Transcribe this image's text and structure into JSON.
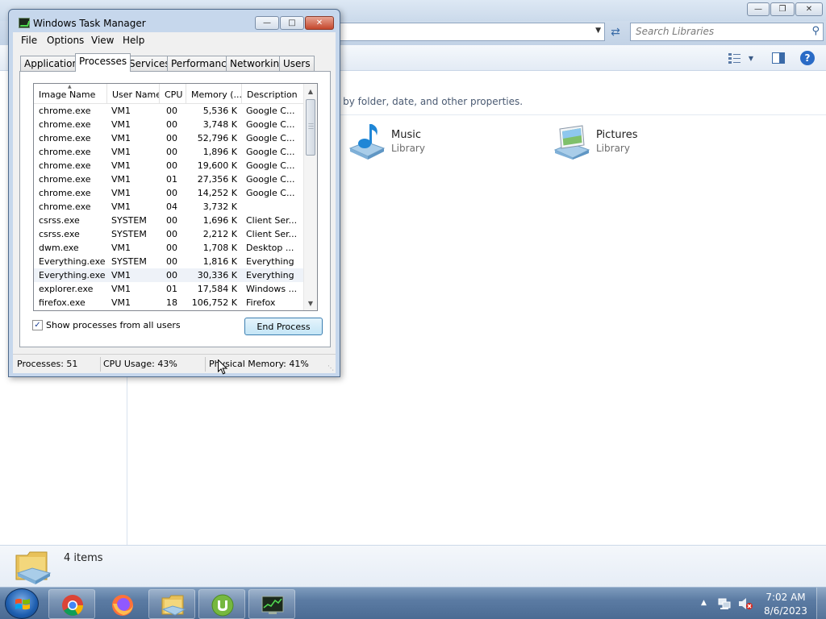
{
  "explorer": {
    "search": {
      "placeholder": "Search Libraries"
    },
    "description": "rn by folder, date, and other properties.",
    "libraries": [
      {
        "name": "Music",
        "sub": "Library"
      },
      {
        "name": "Pictures",
        "sub": "Library"
      }
    ],
    "details": {
      "count": "4 items"
    }
  },
  "taskmgr": {
    "title": "Windows Task Manager",
    "menu": [
      "File",
      "Options",
      "View",
      "Help"
    ],
    "tabs": [
      "Applications",
      "Processes",
      "Services",
      "Performance",
      "Networking",
      "Users"
    ],
    "active_tab": "Processes",
    "columns": [
      "Image Name",
      "User Name",
      "CPU",
      "Memory (...",
      "Description"
    ],
    "rows": [
      {
        "name": "chrome.exe",
        "user": "VM1",
        "cpu": "00",
        "mem": "5,536 K",
        "desc": "Google C..."
      },
      {
        "name": "chrome.exe",
        "user": "VM1",
        "cpu": "00",
        "mem": "3,748 K",
        "desc": "Google C..."
      },
      {
        "name": "chrome.exe",
        "user": "VM1",
        "cpu": "00",
        "mem": "52,796 K",
        "desc": "Google C..."
      },
      {
        "name": "chrome.exe",
        "user": "VM1",
        "cpu": "00",
        "mem": "1,896 K",
        "desc": "Google C..."
      },
      {
        "name": "chrome.exe",
        "user": "VM1",
        "cpu": "00",
        "mem": "19,600 K",
        "desc": "Google C..."
      },
      {
        "name": "chrome.exe",
        "user": "VM1",
        "cpu": "01",
        "mem": "27,356 K",
        "desc": "Google C..."
      },
      {
        "name": "chrome.exe",
        "user": "VM1",
        "cpu": "00",
        "mem": "14,252 K",
        "desc": "Google C..."
      },
      {
        "name": "chrome.exe",
        "user": "VM1",
        "cpu": "04",
        "mem": "3,732 K",
        "desc": ""
      },
      {
        "name": "csrss.exe",
        "user": "SYSTEM",
        "cpu": "00",
        "mem": "1,696 K",
        "desc": "Client Ser..."
      },
      {
        "name": "csrss.exe",
        "user": "SYSTEM",
        "cpu": "00",
        "mem": "2,212 K",
        "desc": "Client Ser..."
      },
      {
        "name": "dwm.exe",
        "user": "VM1",
        "cpu": "00",
        "mem": "1,708 K",
        "desc": "Desktop ..."
      },
      {
        "name": "Everything.exe",
        "user": "SYSTEM",
        "cpu": "00",
        "mem": "1,816 K",
        "desc": "Everything"
      },
      {
        "name": "Everything.exe",
        "user": "VM1",
        "cpu": "00",
        "mem": "30,336 K",
        "desc": "Everything"
      },
      {
        "name": "explorer.exe",
        "user": "VM1",
        "cpu": "01",
        "mem": "17,584 K",
        "desc": "Windows ..."
      },
      {
        "name": "firefox.exe",
        "user": "VM1",
        "cpu": "18",
        "mem": "106,752 K",
        "desc": "Firefox"
      }
    ],
    "selected_row": 12,
    "show_all_label": "Show processes from all users",
    "show_all_checked": true,
    "end_process_label": "End Process",
    "status": {
      "processes": "Processes: 51",
      "cpu": "CPU Usage: 43%",
      "memory": "Physical Memory: 41%"
    }
  },
  "taskbar": {
    "time": "7:02 AM",
    "date": "8/6/2023"
  },
  "colors": {
    "selection_accent": "#3399ff",
    "taskbar": "#5b7ba3",
    "close_button": "#c4472c"
  },
  "icons": [
    "windows-start-icon",
    "chrome-icon",
    "firefox-icon",
    "explorer-icon",
    "utorrent-icon",
    "task-manager-icon",
    "network-icon",
    "volume-muted-icon",
    "search-icon",
    "help-icon",
    "music-library-icon",
    "pictures-library-icon"
  ]
}
